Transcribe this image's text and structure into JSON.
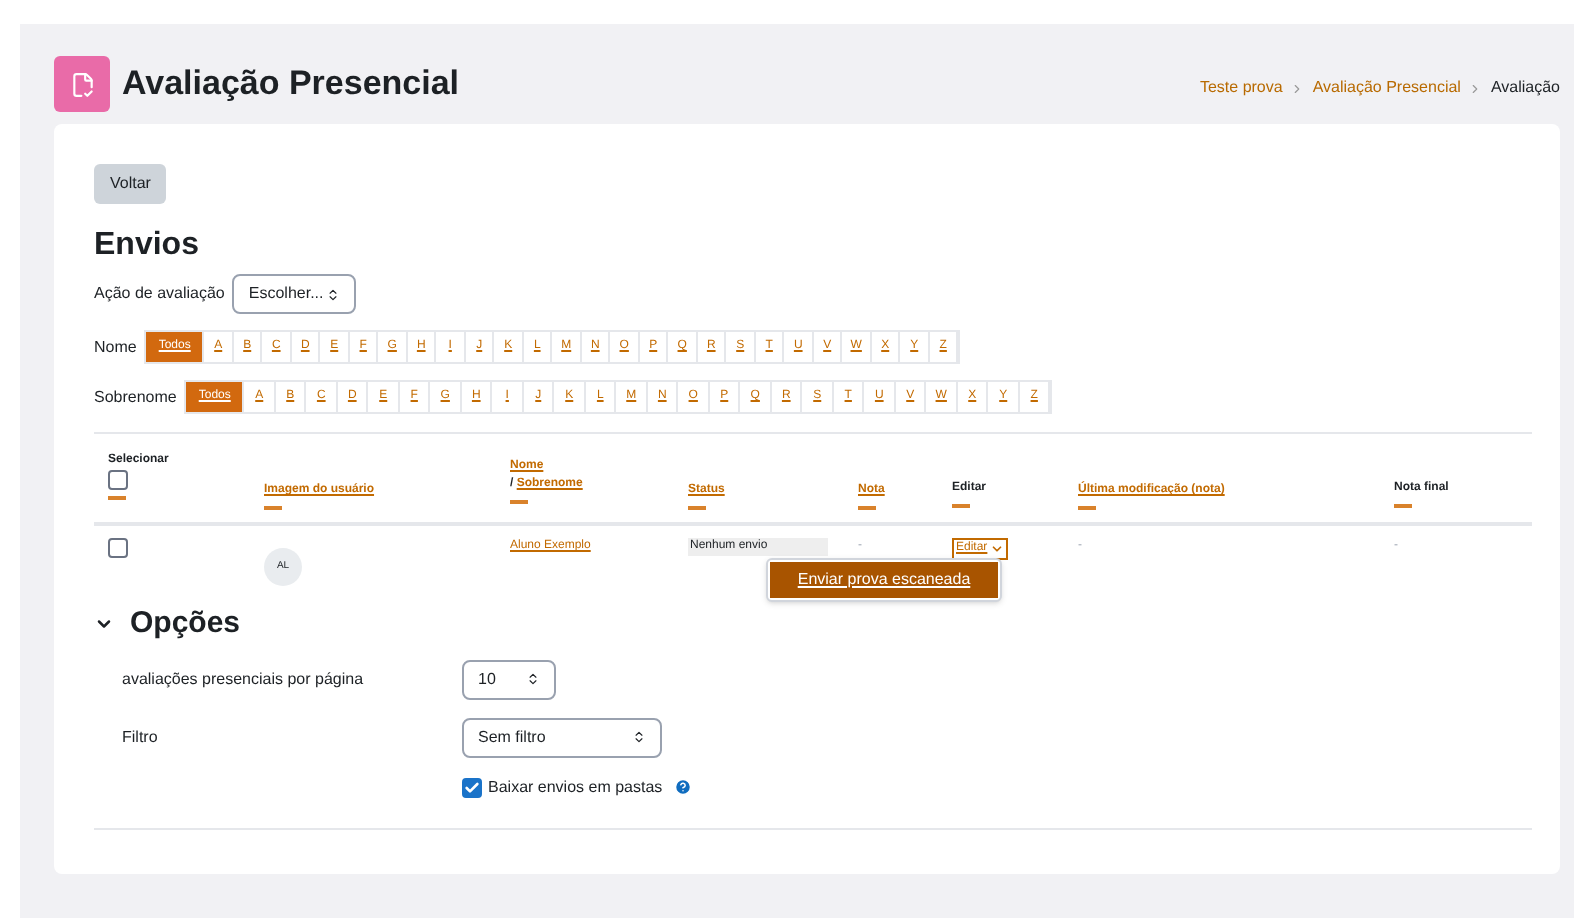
{
  "header": {
    "title": "Avaliação Presencial",
    "breadcrumbs": [
      {
        "label": "Teste prova",
        "link": true
      },
      {
        "label": "Avaliação Presencial",
        "link": true
      },
      {
        "label": "Avaliação",
        "link": false
      }
    ]
  },
  "back_button": "Voltar",
  "section_title": "Envios",
  "grading_action": {
    "label": "Ação de avaliação",
    "value": "Escolher..."
  },
  "initial_filters": [
    {
      "label": "Nome",
      "options": [
        {
          "label": "Todos",
          "selected": true
        },
        {
          "label": "A",
          "selected": false
        },
        {
          "label": "B",
          "selected": false
        },
        {
          "label": "C",
          "selected": false
        },
        {
          "label": "D",
          "selected": false
        },
        {
          "label": "E",
          "selected": false
        },
        {
          "label": "F",
          "selected": false
        },
        {
          "label": "G",
          "selected": false
        },
        {
          "label": "H",
          "selected": false
        },
        {
          "label": "I",
          "selected": false
        },
        {
          "label": "J",
          "selected": false
        },
        {
          "label": "K",
          "selected": false
        },
        {
          "label": "L",
          "selected": false
        },
        {
          "label": "M",
          "selected": false
        },
        {
          "label": "N",
          "selected": false
        },
        {
          "label": "O",
          "selected": false
        },
        {
          "label": "P",
          "selected": false
        },
        {
          "label": "Q",
          "selected": false
        },
        {
          "label": "R",
          "selected": false
        },
        {
          "label": "S",
          "selected": false
        },
        {
          "label": "T",
          "selected": false
        },
        {
          "label": "U",
          "selected": false
        },
        {
          "label": "V",
          "selected": false
        },
        {
          "label": "W",
          "selected": false
        },
        {
          "label": "X",
          "selected": false
        },
        {
          "label": "Y",
          "selected": false
        },
        {
          "label": "Z",
          "selected": false
        }
      ]
    },
    {
      "label": "Sobrenome",
      "options": [
        {
          "label": "Todos",
          "selected": true
        },
        {
          "label": "A",
          "selected": false
        },
        {
          "label": "B",
          "selected": false
        },
        {
          "label": "C",
          "selected": false
        },
        {
          "label": "D",
          "selected": false
        },
        {
          "label": "E",
          "selected": false
        },
        {
          "label": "F",
          "selected": false
        },
        {
          "label": "G",
          "selected": false
        },
        {
          "label": "H",
          "selected": false
        },
        {
          "label": "I",
          "selected": false
        },
        {
          "label": "J",
          "selected": false
        },
        {
          "label": "K",
          "selected": false
        },
        {
          "label": "L",
          "selected": false
        },
        {
          "label": "M",
          "selected": false
        },
        {
          "label": "N",
          "selected": false
        },
        {
          "label": "O",
          "selected": false
        },
        {
          "label": "P",
          "selected": false
        },
        {
          "label": "Q",
          "selected": false
        },
        {
          "label": "R",
          "selected": false
        },
        {
          "label": "S",
          "selected": false
        },
        {
          "label": "T",
          "selected": false
        },
        {
          "label": "U",
          "selected": false
        },
        {
          "label": "V",
          "selected": false
        },
        {
          "label": "W",
          "selected": false
        },
        {
          "label": "X",
          "selected": false
        },
        {
          "label": "Y",
          "selected": false
        },
        {
          "label": "Z",
          "selected": false
        }
      ]
    }
  ],
  "table": {
    "columns": [
      {
        "kind": "select",
        "label": "Selecionar",
        "checked": false
      },
      {
        "kind": "sort",
        "label": "Imagem do usuário"
      },
      {
        "kind": "name",
        "label": "Nome",
        "label2": "/ Sobrenome"
      },
      {
        "kind": "sort",
        "label": "Status"
      },
      {
        "kind": "sort",
        "label": "Nota"
      },
      {
        "kind": "plain",
        "label": "Editar"
      },
      {
        "kind": "sort",
        "label": "Última modificação (nota)"
      },
      {
        "kind": "plain",
        "label": "Nota final"
      }
    ],
    "rows": [
      {
        "checked": false,
        "avatar": "AL",
        "name": "Aluno Exemplo",
        "status": "Nenhum envio",
        "grade": "-",
        "edit": "Editar",
        "last_modified": "-",
        "final_grade": "-",
        "menu_open": true,
        "menu_items": [
          "Enviar prova escaneada"
        ]
      }
    ]
  },
  "options": {
    "title": "Opções",
    "expanded": true,
    "per_page": {
      "label": "avaliações presenciais por página",
      "value": "10"
    },
    "filter": {
      "label": "Filtro",
      "value": "Sem filtro"
    },
    "download_folders": {
      "label": "Baixar envios em pastas",
      "checked": true
    }
  }
}
